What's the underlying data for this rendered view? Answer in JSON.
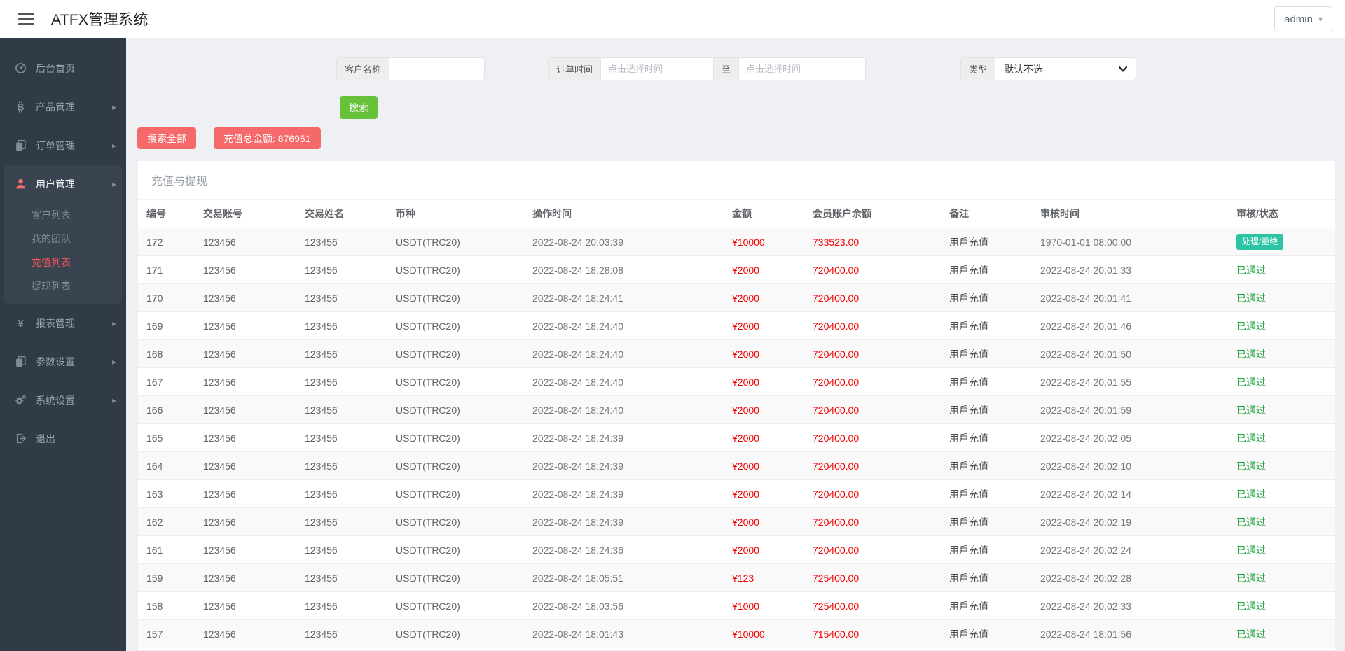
{
  "header": {
    "title": "ATFX管理系统",
    "user_label": "admin"
  },
  "sidebar": {
    "items": [
      {
        "id": "dashboard",
        "label": "后台首页",
        "icon": "dashboard",
        "expandable": false
      },
      {
        "id": "products",
        "label": "产品管理",
        "icon": "bitcoin",
        "expandable": true
      },
      {
        "id": "orders",
        "label": "订单管理",
        "icon": "files",
        "expandable": true
      },
      {
        "id": "users",
        "label": "用户管理",
        "icon": "user",
        "expandable": true,
        "active": true,
        "children": [
          {
            "id": "customer-list",
            "label": "客户列表",
            "active": false
          },
          {
            "id": "my-team",
            "label": "我的团队",
            "active": false
          },
          {
            "id": "recharge-list",
            "label": "充值列表",
            "active": true
          },
          {
            "id": "withdraw-list",
            "label": "提现列表",
            "active": false
          }
        ]
      },
      {
        "id": "reports",
        "label": "报表管理",
        "icon": "yen",
        "expandable": true
      },
      {
        "id": "params",
        "label": "参数设置",
        "icon": "files",
        "expandable": true
      },
      {
        "id": "system",
        "label": "系统设置",
        "icon": "gears",
        "expandable": true
      },
      {
        "id": "logout",
        "label": "退出",
        "icon": "logout",
        "expandable": false
      }
    ]
  },
  "filters": {
    "customer_name_label": "客户名称",
    "order_time_label": "订单时间",
    "time_placeholder": "点击选择时间",
    "to_label": "至",
    "type_label": "类型",
    "type_value": "默认不选",
    "search_button": "搜索",
    "search_all_button": "搜索全部",
    "total_button": "充值总金额: 876951"
  },
  "table": {
    "card_title": "充值与提现",
    "columns": [
      "编号",
      "交易账号",
      "交易姓名",
      "币种",
      "操作时间",
      "金额",
      "会员账户余额",
      "备注",
      "审核时间",
      "审核/状态"
    ],
    "rows": [
      {
        "id": "172",
        "account": "123456",
        "name": "123456",
        "currency": "USDT(TRC20)",
        "op_time": "2022-08-24 20:03:39",
        "amount": "¥10000",
        "balance": "733523.00",
        "remark": "用戶充值",
        "audit_time": "1970-01-01 08:00:00",
        "status": "处理/拒绝",
        "status_type": "pending"
      },
      {
        "id": "171",
        "account": "123456",
        "name": "123456",
        "currency": "USDT(TRC20)",
        "op_time": "2022-08-24 18:28:08",
        "amount": "¥2000",
        "balance": "720400.00",
        "remark": "用戶充值",
        "audit_time": "2022-08-24 20:01:33",
        "status": "已通过",
        "status_type": "approved"
      },
      {
        "id": "170",
        "account": "123456",
        "name": "123456",
        "currency": "USDT(TRC20)",
        "op_time": "2022-08-24 18:24:41",
        "amount": "¥2000",
        "balance": "720400.00",
        "remark": "用戶充值",
        "audit_time": "2022-08-24 20:01:41",
        "status": "已通过",
        "status_type": "approved"
      },
      {
        "id": "169",
        "account": "123456",
        "name": "123456",
        "currency": "USDT(TRC20)",
        "op_time": "2022-08-24 18:24:40",
        "amount": "¥2000",
        "balance": "720400.00",
        "remark": "用戶充值",
        "audit_time": "2022-08-24 20:01:46",
        "status": "已通过",
        "status_type": "approved"
      },
      {
        "id": "168",
        "account": "123456",
        "name": "123456",
        "currency": "USDT(TRC20)",
        "op_time": "2022-08-24 18:24:40",
        "amount": "¥2000",
        "balance": "720400.00",
        "remark": "用戶充值",
        "audit_time": "2022-08-24 20:01:50",
        "status": "已通过",
        "status_type": "approved"
      },
      {
        "id": "167",
        "account": "123456",
        "name": "123456",
        "currency": "USDT(TRC20)",
        "op_time": "2022-08-24 18:24:40",
        "amount": "¥2000",
        "balance": "720400.00",
        "remark": "用戶充值",
        "audit_time": "2022-08-24 20:01:55",
        "status": "已通过",
        "status_type": "approved"
      },
      {
        "id": "166",
        "account": "123456",
        "name": "123456",
        "currency": "USDT(TRC20)",
        "op_time": "2022-08-24 18:24:40",
        "amount": "¥2000",
        "balance": "720400.00",
        "remark": "用戶充值",
        "audit_time": "2022-08-24 20:01:59",
        "status": "已通过",
        "status_type": "approved"
      },
      {
        "id": "165",
        "account": "123456",
        "name": "123456",
        "currency": "USDT(TRC20)",
        "op_time": "2022-08-24 18:24:39",
        "amount": "¥2000",
        "balance": "720400.00",
        "remark": "用戶充值",
        "audit_time": "2022-08-24 20:02:05",
        "status": "已通过",
        "status_type": "approved"
      },
      {
        "id": "164",
        "account": "123456",
        "name": "123456",
        "currency": "USDT(TRC20)",
        "op_time": "2022-08-24 18:24:39",
        "amount": "¥2000",
        "balance": "720400.00",
        "remark": "用戶充值",
        "audit_time": "2022-08-24 20:02:10",
        "status": "已通过",
        "status_type": "approved"
      },
      {
        "id": "163",
        "account": "123456",
        "name": "123456",
        "currency": "USDT(TRC20)",
        "op_time": "2022-08-24 18:24:39",
        "amount": "¥2000",
        "balance": "720400.00",
        "remark": "用戶充值",
        "audit_time": "2022-08-24 20:02:14",
        "status": "已通过",
        "status_type": "approved"
      },
      {
        "id": "162",
        "account": "123456",
        "name": "123456",
        "currency": "USDT(TRC20)",
        "op_time": "2022-08-24 18:24:39",
        "amount": "¥2000",
        "balance": "720400.00",
        "remark": "用戶充值",
        "audit_time": "2022-08-24 20:02:19",
        "status": "已通过",
        "status_type": "approved"
      },
      {
        "id": "161",
        "account": "123456",
        "name": "123456",
        "currency": "USDT(TRC20)",
        "op_time": "2022-08-24 18:24:36",
        "amount": "¥2000",
        "balance": "720400.00",
        "remark": "用戶充值",
        "audit_time": "2022-08-24 20:02:24",
        "status": "已通过",
        "status_type": "approved"
      },
      {
        "id": "159",
        "account": "123456",
        "name": "123456",
        "currency": "USDT(TRC20)",
        "op_time": "2022-08-24 18:05:51",
        "amount": "¥123",
        "balance": "725400.00",
        "remark": "用戶充值",
        "audit_time": "2022-08-24 20:02:28",
        "status": "已通过",
        "status_type": "approved"
      },
      {
        "id": "158",
        "account": "123456",
        "name": "123456",
        "currency": "USDT(TRC20)",
        "op_time": "2022-08-24 18:03:56",
        "amount": "¥1000",
        "balance": "725400.00",
        "remark": "用戶充值",
        "audit_time": "2022-08-24 20:02:33",
        "status": "已通过",
        "status_type": "approved"
      },
      {
        "id": "157",
        "account": "123456",
        "name": "123456",
        "currency": "USDT(TRC20)",
        "op_time": "2022-08-24 18:01:43",
        "amount": "¥10000",
        "balance": "715400.00",
        "remark": "用戶充值",
        "audit_time": "2022-08-24 18:01:56",
        "status": "已通过",
        "status_type": "approved"
      }
    ]
  },
  "colors": {
    "sidebar_bg": "#303b47",
    "sidebar_active_red": "#fa5555",
    "button_green": "#67c23a",
    "button_red": "#f6696a",
    "badge_teal": "#2bc5a4",
    "approved_green": "#1aa23b",
    "amount_red": "#f50000"
  }
}
